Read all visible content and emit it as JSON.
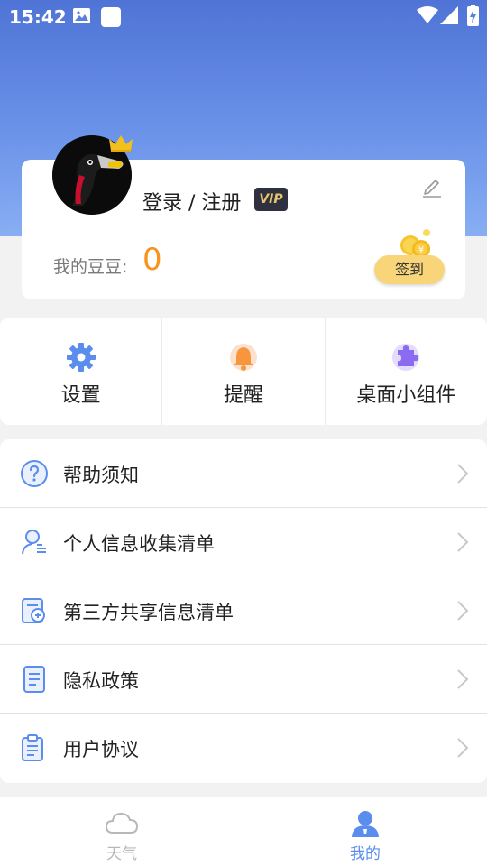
{
  "status_bar": {
    "time": "15:42",
    "left_icons": [
      "image-icon",
      "square-icon"
    ],
    "right_icons": [
      "wifi-icon",
      "signal-icon",
      "battery-charging-icon"
    ]
  },
  "profile": {
    "login_text": "登录 / 注册",
    "vip_label": "VIP",
    "beans_label": "我的豆豆:",
    "beans_value": "0",
    "signin_label": "签到"
  },
  "quick_actions": [
    {
      "label": "设置",
      "icon": "gear-icon"
    },
    {
      "label": "提醒",
      "icon": "bell-icon"
    },
    {
      "label": "桌面小组件",
      "icon": "puzzle-icon"
    }
  ],
  "menu": [
    {
      "label": "帮助须知",
      "icon": "help-icon"
    },
    {
      "label": "个人信息收集清单",
      "icon": "personal-info-icon"
    },
    {
      "label": "第三方共享信息清单",
      "icon": "shared-info-icon"
    },
    {
      "label": "隐私政策",
      "icon": "privacy-doc-icon"
    },
    {
      "label": "用户协议",
      "icon": "agreement-icon"
    }
  ],
  "bottom_nav": [
    {
      "label": "天气",
      "icon": "cloud-icon",
      "active": false
    },
    {
      "label": "我的",
      "icon": "person-icon",
      "active": true
    }
  ],
  "colors": {
    "hero_top": "#4f74d6",
    "hero_bottom": "#88aef3",
    "accent_blue": "#5b8def",
    "beans_orange": "#f7931e",
    "signin_yellow": "#f9d57a",
    "nav_inactive": "#b8b8b8"
  }
}
